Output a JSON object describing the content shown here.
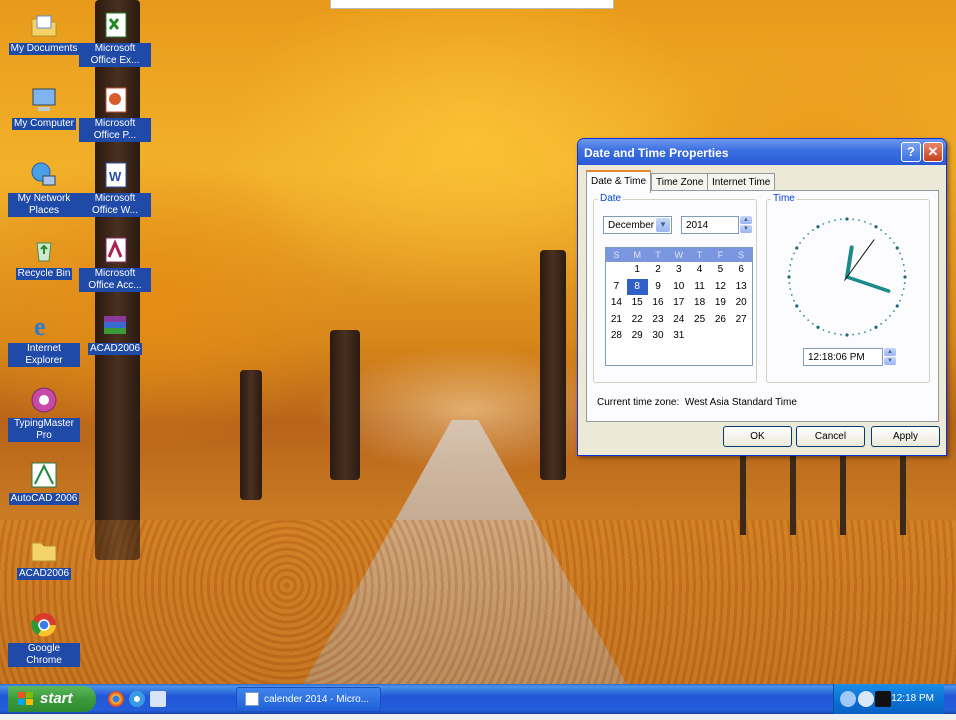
{
  "desktop": {
    "icons": [
      {
        "label": "My Documents",
        "icon": "folder-documents-icon"
      },
      {
        "label": "Microsoft Office Ex...",
        "icon": "excel-icon"
      },
      {
        "label": "My Computer",
        "icon": "computer-icon"
      },
      {
        "label": "Microsoft Office P...",
        "icon": "powerpoint-icon"
      },
      {
        "label": "My Network Places",
        "icon": "network-icon"
      },
      {
        "label": "Microsoft Office W...",
        "icon": "word-icon"
      },
      {
        "label": "Recycle Bin",
        "icon": "recycle-bin-icon"
      },
      {
        "label": "Microsoft Office Acc...",
        "icon": "access-icon"
      },
      {
        "label": "Internet Explorer",
        "icon": "internet-explorer-icon"
      },
      {
        "label": "ACAD2006",
        "icon": "winrar-icon"
      },
      {
        "label": "TypingMaster Pro",
        "icon": "typingmaster-icon"
      },
      {
        "label": "AutoCAD 2006",
        "icon": "autocad-icon"
      },
      {
        "label": "ACAD2006",
        "icon": "folder-icon"
      },
      {
        "label": "Google Chrome",
        "icon": "chrome-icon"
      }
    ]
  },
  "dialog": {
    "title": "Date and Time Properties",
    "help": "?",
    "close": "✕",
    "tabs": [
      {
        "label": "Date & Time",
        "active": true
      },
      {
        "label": "Time Zone",
        "active": false
      },
      {
        "label": "Internet Time",
        "active": false
      }
    ],
    "date_group": {
      "title": "Date",
      "month": "December",
      "year": "2014",
      "weekdays": [
        "S",
        "M",
        "T",
        "W",
        "T",
        "F",
        "S"
      ],
      "weeks": [
        [
          "",
          "1",
          "2",
          "3",
          "4",
          "5",
          "6"
        ],
        [
          "7",
          "8",
          "9",
          "10",
          "11",
          "12",
          "13"
        ],
        [
          "14",
          "15",
          "16",
          "17",
          "18",
          "19",
          "20"
        ],
        [
          "21",
          "22",
          "23",
          "24",
          "25",
          "26",
          "27"
        ],
        [
          "28",
          "29",
          "30",
          "31",
          "",
          "",
          ""
        ]
      ],
      "selected_day": "8"
    },
    "time_group": {
      "title": "Time",
      "time_value": "12:18:06 PM",
      "clock": {
        "hour": 12,
        "minute": 18,
        "second": 6
      }
    },
    "timezone_label": "Current time zone:",
    "timezone_value": "West Asia Standard Time",
    "buttons": {
      "ok": "OK",
      "cancel": "Cancel",
      "apply": "Apply"
    }
  },
  "taskbar": {
    "start_label": "start",
    "task_button": "calender 2014 - Micro...",
    "clock": "12:18 PM",
    "accent": "#245edb"
  }
}
